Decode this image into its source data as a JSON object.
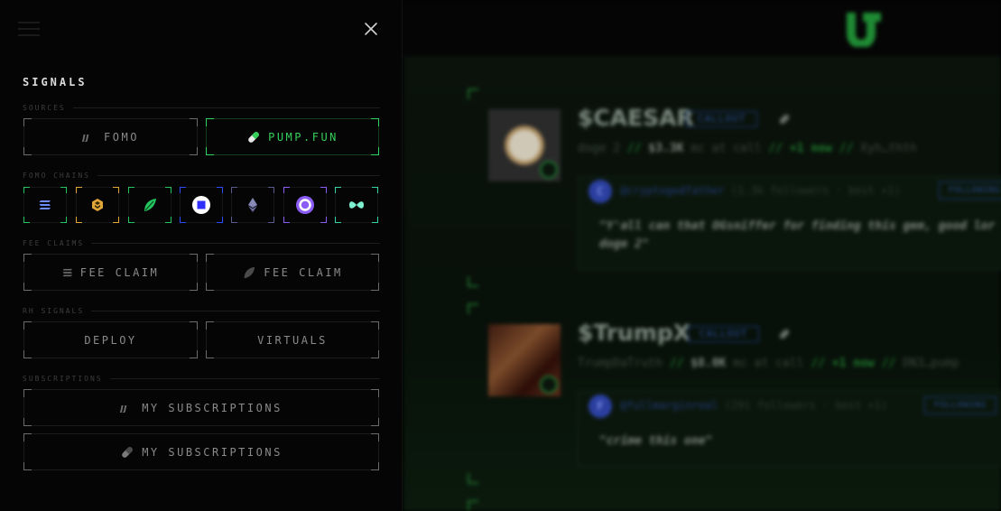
{
  "drawer": {
    "title": "SIGNALS",
    "sections": {
      "sources": "SOURCES",
      "fomo_chains": "FOMO CHAINS",
      "fee_claims": "FEE CLAIMS",
      "rh_signals": "RH SIGNALS",
      "subscriptions": "SUBSCRIPTIONS"
    },
    "sources": [
      {
        "label": "FOMO",
        "icon": "fomo-icon",
        "active": false
      },
      {
        "label": "PUMP.FUN",
        "icon": "pill-icon",
        "active": true
      }
    ],
    "chains": [
      {
        "name": "solana",
        "icon": "solana-icon",
        "color": "#22c55e"
      },
      {
        "name": "bnb",
        "icon": "bnb-icon",
        "color": "#e0a63a"
      },
      {
        "name": "pump",
        "icon": "leaf-icon",
        "color": "#22c55e"
      },
      {
        "name": "base",
        "icon": "base-icon",
        "color": "#2f4bff"
      },
      {
        "name": "ethereum",
        "icon": "ethereum-icon",
        "color": "#7a7aa8"
      },
      {
        "name": "abstract",
        "icon": "ring-icon",
        "color": "#8b5cf6"
      },
      {
        "name": "hyperliquid",
        "icon": "hyperliquid-icon",
        "color": "#34d3a8"
      }
    ],
    "fee_claims": [
      {
        "label": "FEE CLAIM",
        "icon": "solana-icon"
      },
      {
        "label": "FEE CLAIM",
        "icon": "leaf-icon"
      }
    ],
    "rh_signals": [
      {
        "label": "DEPLOY"
      },
      {
        "label": "VIRTUALS"
      }
    ],
    "subscriptions": [
      {
        "label": "MY SUBSCRIPTIONS",
        "icon": "fomo-icon"
      },
      {
        "label": "MY SUBSCRIPTIONS",
        "icon": "pill-icon"
      }
    ]
  },
  "feed": {
    "cards": [
      {
        "ticker": "$CAESAR",
        "badge": "CALLOUT",
        "sub_name": "doge 2",
        "sub_sep": "//",
        "sub_mc": "$3.3K",
        "sub_mc_label": "mc at call",
        "sub_change": "+1 now",
        "sub_addr": "Xyh…thth",
        "caller_initial": "C",
        "caller_handle": "@cryptogodfather",
        "caller_meta": "(1.3k followers · best +1)",
        "follow_label": "FOLLOWING",
        "quote_line1": "\"Y'all can that OGsniffer for finding this gem, good lor",
        "quote_line2": "doge 2\""
      },
      {
        "ticker": "$TrumpX",
        "badge": "CALLOUT",
        "sub_name": "TrumpDaTruth",
        "sub_sep": "//",
        "sub_mc": "$8.0K",
        "sub_mc_label": "mc at call",
        "sub_change": "+1 now",
        "sub_addr": "DN3…pump",
        "caller_initial": "F",
        "caller_handle": "@fullmarginreal",
        "caller_meta": "(291 followers · best +1)",
        "follow_label": "FOLLOWING",
        "quote_line1": "\"crime this one\"",
        "quote_line2": ""
      }
    ]
  },
  "colors": {
    "accent_green": "#33d35e",
    "callout_blue": "#2a4fa0",
    "drawer_bg": "#050505"
  }
}
